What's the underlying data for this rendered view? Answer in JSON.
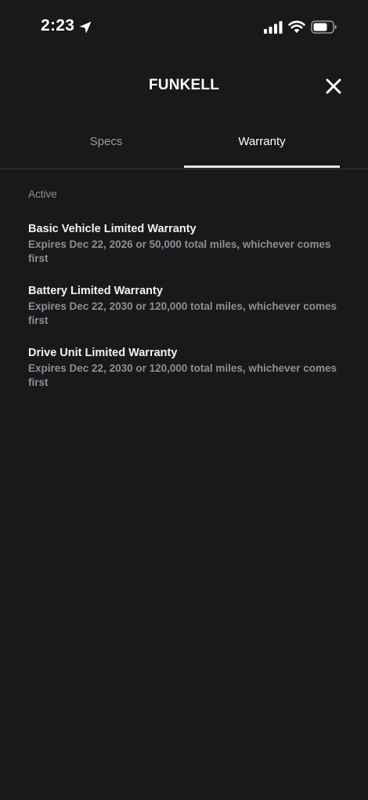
{
  "status_bar": {
    "time": "2:23",
    "icons": [
      "location-arrow-icon",
      "cellular-signal-icon",
      "wifi-icon",
      "battery-icon"
    ]
  },
  "header": {
    "title": "FUNKELL",
    "close_icon": "close-icon"
  },
  "tabs": [
    {
      "label": "Specs",
      "active": false
    },
    {
      "label": "Warranty",
      "active": true
    }
  ],
  "warranty": {
    "section_label": "Active",
    "items": [
      {
        "title": "Basic Vehicle Limited Warranty",
        "description": "Expires Dec 22, 2026 or 50,000 total miles, whichever comes first"
      },
      {
        "title": "Battery Limited Warranty",
        "description": "Expires Dec 22, 2030 or 120,000 total miles, whichever comes first"
      },
      {
        "title": "Drive Unit Limited Warranty",
        "description": "Expires Dec 22, 2030 or 120,000 total miles, whichever comes first"
      }
    ]
  },
  "colors": {
    "background": "#18191b",
    "text_primary": "#ffffff",
    "text_secondary": "#8e8f93",
    "tab_indicator": "#e6e6e6",
    "divider": "#3a3b3e"
  }
}
